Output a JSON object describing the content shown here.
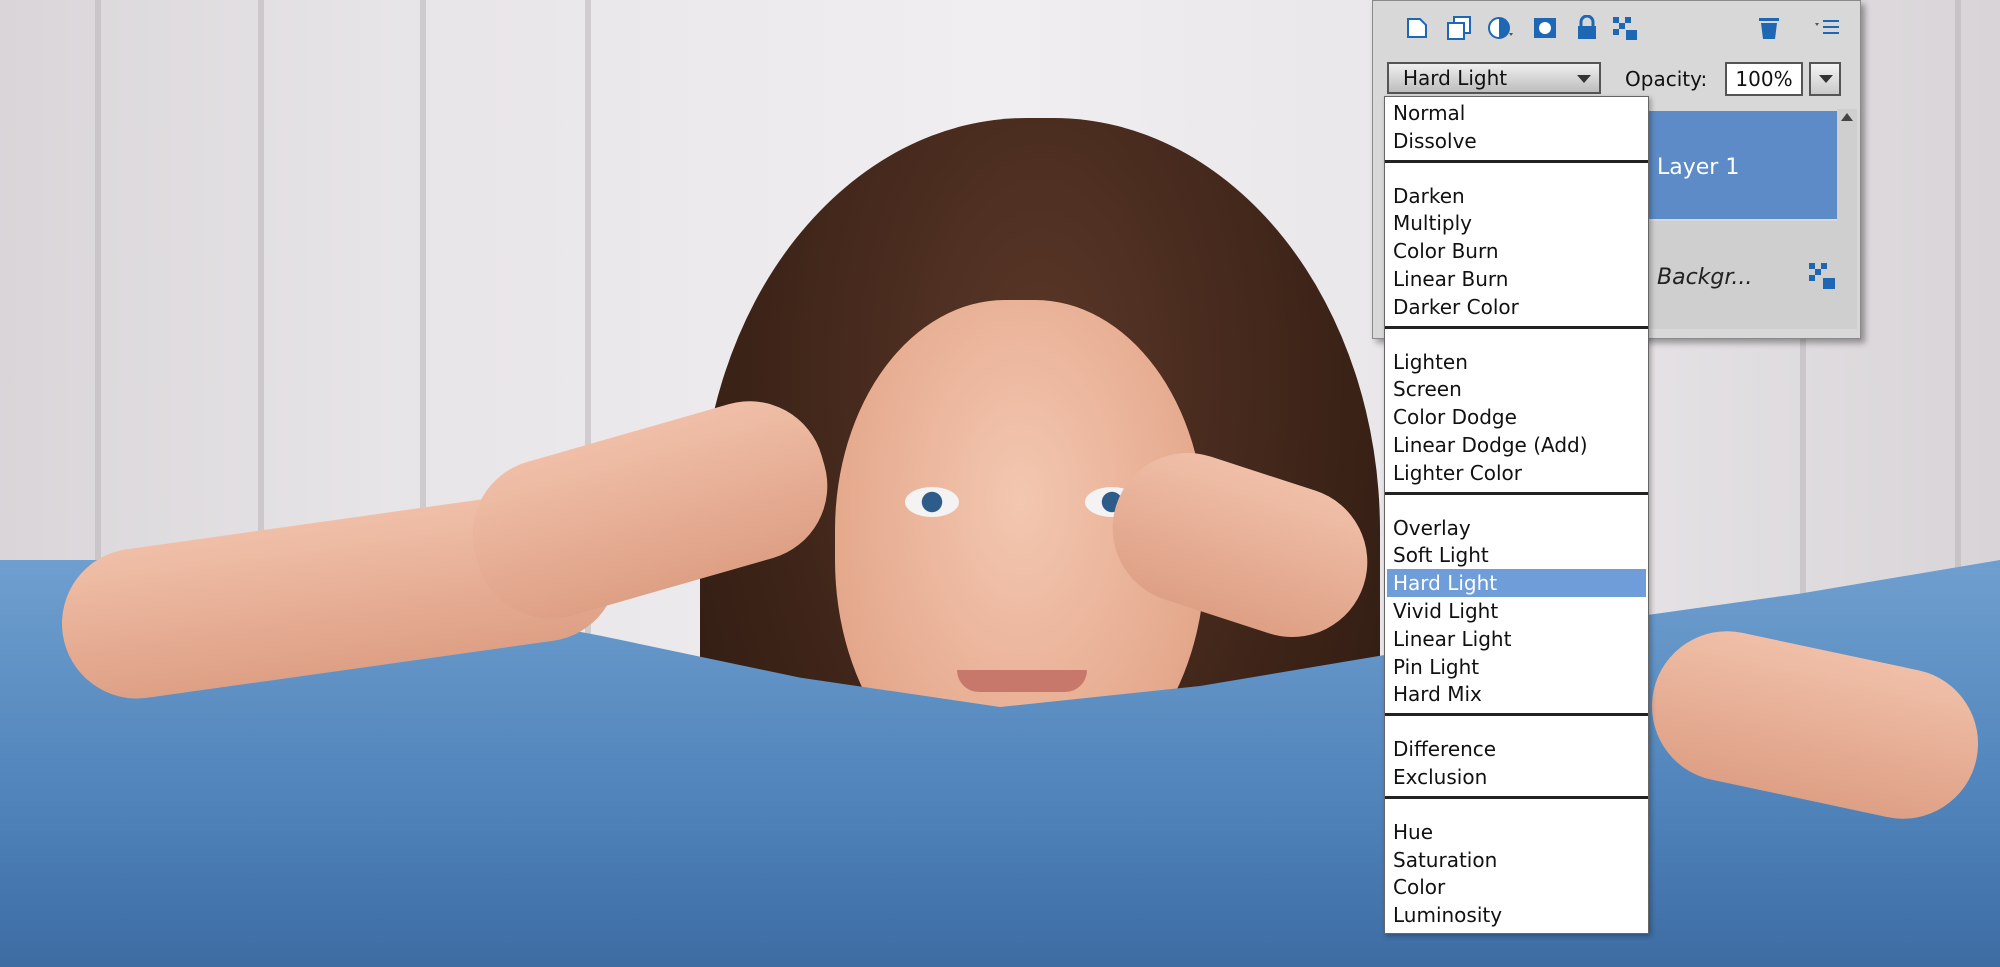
{
  "panel": {
    "toolbar_icons": [
      "new-layer-icon",
      "duplicate-layer-icon",
      "adjustment-layer-icon",
      "layer-mask-icon",
      "lock-all-icon",
      "lock-transparency-icon",
      "trash-icon",
      "panel-menu-icon"
    ],
    "blend_mode": "Hard Light",
    "opacity_label": "Opacity:",
    "opacity_value": "100%",
    "layers": [
      {
        "name": "Layer 1"
      },
      {
        "name": "Backgr..."
      }
    ]
  },
  "blend_menu": {
    "groups": [
      [
        "Normal",
        "Dissolve"
      ],
      [
        "Darken",
        "Multiply",
        "Color Burn",
        "Linear Burn",
        "Darker Color"
      ],
      [
        "Lighten",
        "Screen",
        "Color Dodge",
        "Linear Dodge (Add)",
        "Lighter Color"
      ],
      [
        "Overlay",
        "Soft Light",
        "Hard Light",
        "Vivid Light",
        "Linear Light",
        "Pin Light",
        "Hard Mix"
      ],
      [
        "Difference",
        "Exclusion"
      ],
      [
        "Hue",
        "Saturation",
        "Color",
        "Luminosity"
      ]
    ],
    "selected": "Hard Light"
  },
  "colors": {
    "accent": "#1d67b4",
    "selection": "#6f9dda",
    "active_layer": "#5c8bc7"
  }
}
